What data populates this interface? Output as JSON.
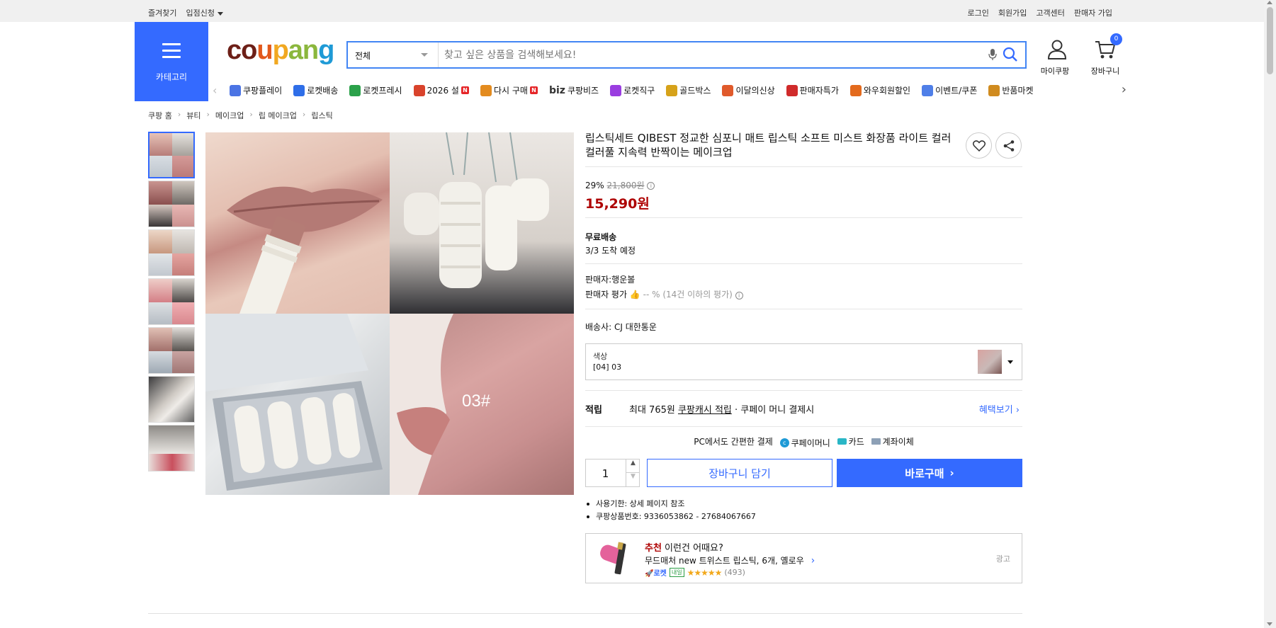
{
  "topbar": {
    "left": [
      "즐겨찾기",
      "입점신청"
    ],
    "right": [
      "로그인",
      "회원가입",
      "고객센터",
      "판매자 가입"
    ]
  },
  "header": {
    "category_label": "카테고리",
    "logo": [
      "co",
      "u",
      "p",
      "an",
      "g"
    ],
    "search": {
      "category": "전체",
      "placeholder": "찾고 싶은 상품을 검색해보세요!"
    },
    "my_label": "마이쿠팡",
    "cart_label": "장바구니",
    "cart_count": "0"
  },
  "catnav": [
    {
      "icon": "play-icon",
      "label": "쿠팡플레이",
      "color": "#4b74e4"
    },
    {
      "icon": "rocket-icon",
      "label": "로켓배송",
      "color": "#2f6ee8"
    },
    {
      "icon": "rocket-fresh-icon",
      "label": "로켓프레시",
      "color": "#2ba14a"
    },
    {
      "icon": "gift-icon",
      "label": "2026 설",
      "color": "#d9432c",
      "new": "N"
    },
    {
      "icon": "reorder-icon",
      "label": "다시 구매",
      "color": "#e38b1f",
      "new": "N"
    },
    {
      "icon": "biz-icon",
      "label": "쿠팡비즈",
      "color": "#333333",
      "prefix": "biz"
    },
    {
      "icon": "global-icon",
      "label": "로켓직구",
      "color": "#9a3de0"
    },
    {
      "icon": "goldbox-icon",
      "label": "골드박스",
      "color": "#d6a21a"
    },
    {
      "icon": "new-item-icon",
      "label": "이달의신상",
      "color": "#e05a2b"
    },
    {
      "icon": "seller-special-icon",
      "label": "판매자특가",
      "color": "#d02b2b"
    },
    {
      "icon": "wow-icon",
      "label": "와우회원할인",
      "color": "#e36a1d"
    },
    {
      "icon": "coupon-icon",
      "label": "이벤트/쿠폰",
      "color": "#4f7fe8"
    },
    {
      "icon": "pet-market-icon",
      "label": "반품마켓",
      "color": "#d08b1f"
    }
  ],
  "breadcrumb": [
    "쿠팡 홈",
    "뷰티",
    "메이크업",
    "립 메이크업",
    "립스틱"
  ],
  "product": {
    "title": "립스틱세트 QIBEST 정교한 심포니 매트 립스틱 소프트 미스트 화장품 라이트 컬러 컬러풀 지속력 반짝이는 메이크업",
    "discount": "29%",
    "original_price": "21,800원",
    "sale_price": "15,290원",
    "shipping": "무료배송",
    "arrival": "3/3 도착 예정",
    "seller": "판매자:행운볼",
    "seller_rating_label": "판매자 평가",
    "seller_rating": "-- % (14건 이하의 평가)",
    "courier": "배송사:  CJ 대한통운",
    "option_label": "색상",
    "option_value": "[04] 03",
    "image_text": "03#",
    "swatch_colors": [
      "#d8a3a0",
      "#c9b9b7",
      "#7a5552"
    ]
  },
  "reward": {
    "label": "적립",
    "text_prefix": "최대 765원",
    "text_link": "쿠팡캐시 적립",
    "text_suffix": "· 쿠페이 머니 결제시",
    "more": "혜택보기"
  },
  "pay": {
    "title": "PC에서도 간편한 결제",
    "methods": [
      "쿠페이머니",
      "카드",
      "계좌이체"
    ]
  },
  "purchase": {
    "qty": "1",
    "cart_button": "장바구니 담기",
    "buy_button": "바로구매"
  },
  "notes": [
    "사용기한: 상세 페이지 참조",
    "쿠팡상품번호: 9336053862 - 27684067667"
  ],
  "recommend": {
    "head_strong": "추천",
    "head_rest": " 이런건 어때요?",
    "title": "무드매처 new 트위스트 립스틱, 6개, 옐로우",
    "rocket": "로켓",
    "tomorrow": "내일",
    "rating": 4.5,
    "stars": "★★★★★",
    "count": "(493)",
    "ad": "광고"
  }
}
